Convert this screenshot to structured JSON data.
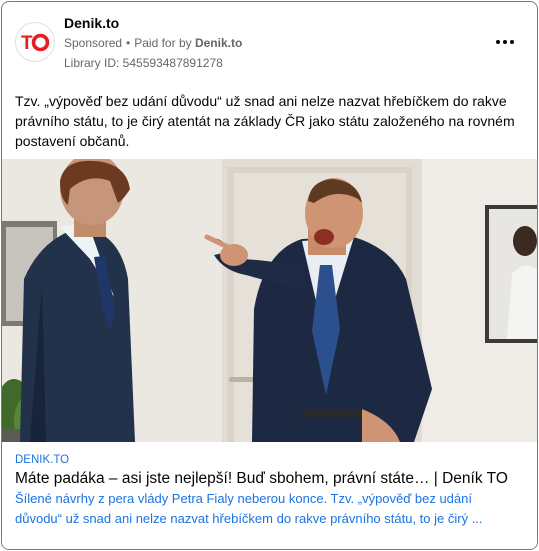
{
  "header": {
    "page_name": "Denik.to",
    "sponsored": "Sponsored",
    "separator": "•",
    "paid_for_prefix": "Paid for by",
    "paid_for_name": "Denik.to",
    "library_id": "Library ID: 545593487891278",
    "logo_text": "TO",
    "more_icon": "more-horizontal-icon"
  },
  "post": {
    "text": "Tzv. „výpověď bez udání důvodu“ už snad ani nelze nazvat hřebíčkem do rakve právního státu, to je čirý atentát na základy ČR jako státu založeného na rovném postavení občanů."
  },
  "link_preview": {
    "domain": "DENIK.TO",
    "title": "Máte padáka – asi jste nejlepší! Buď sbohem, právní státe… | Deník TO",
    "description": "Šílené návrhy z pera vlády Petra Fialy neberou konce. Tzv. „výpověď bez udání důvodu“ už snad ani nelze nazvat hřebíčkem do rakve právního státu, to je čirý ..."
  },
  "colors": {
    "brand_red": "#e31e24",
    "link_blue": "#1b74e4",
    "meta_gray": "#65676b"
  }
}
